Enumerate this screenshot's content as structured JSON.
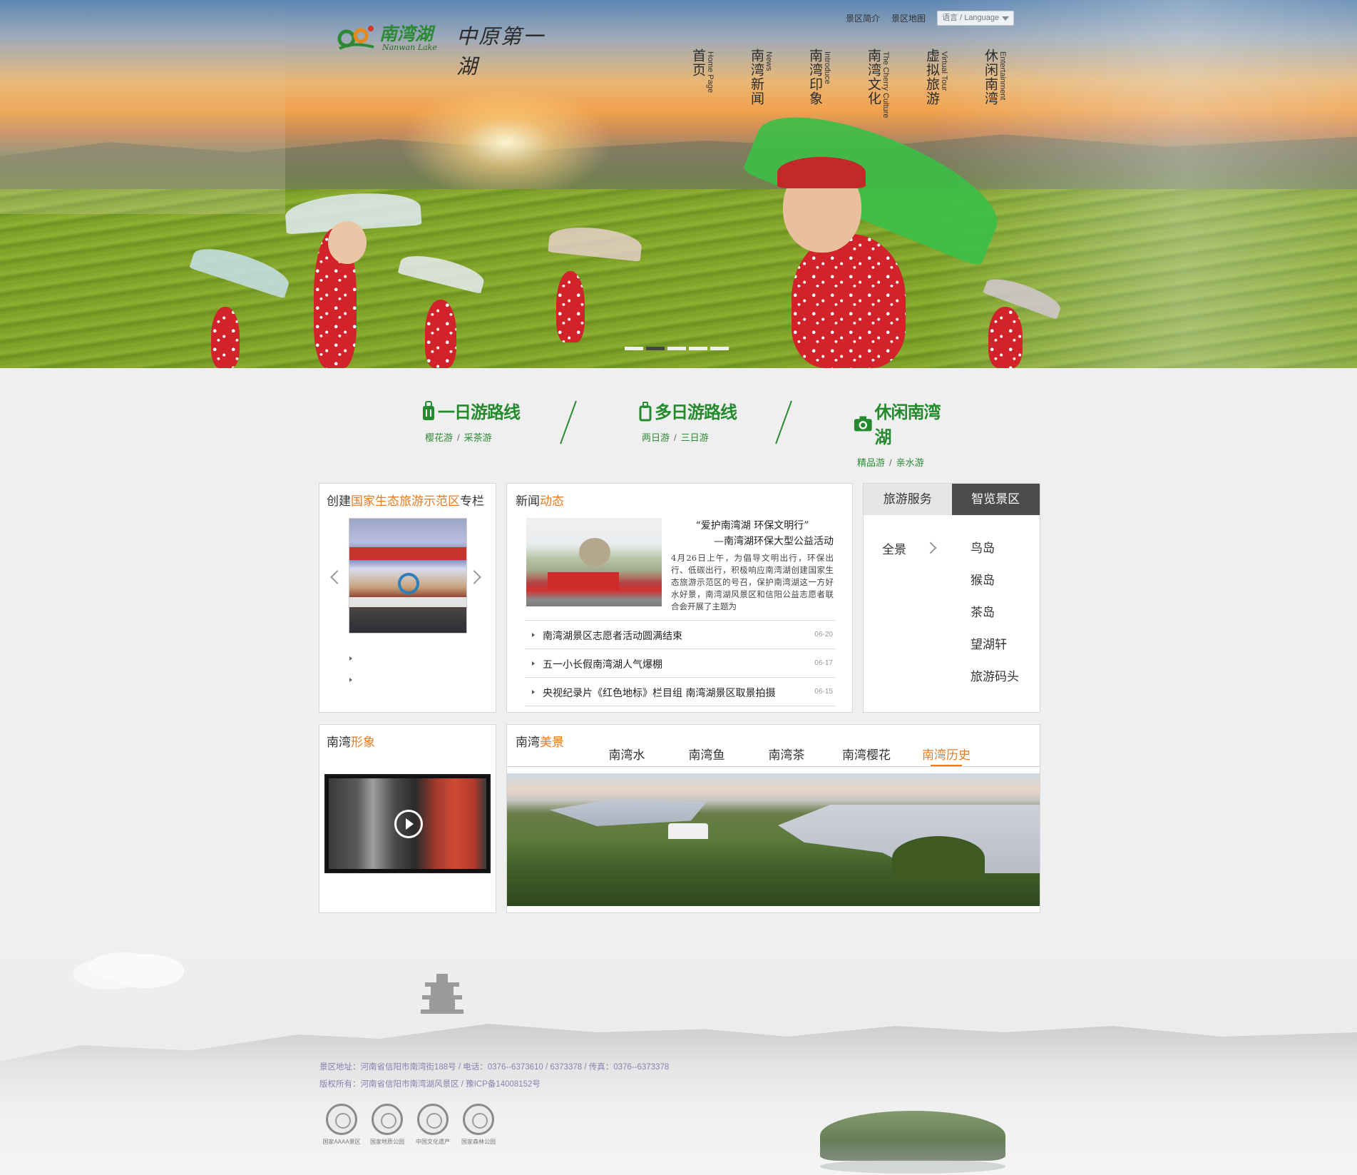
{
  "brand": {
    "name": "南湾湖",
    "english": "Nanwan Lake",
    "slogan": "中原第一湖",
    "green": "#248a2d",
    "orange": "#ec7a1f"
  },
  "top_links": {
    "intro": "景区简介",
    "map": "景区地图",
    "language": "语言 / Language"
  },
  "nav": [
    {
      "zh": "首页",
      "en": "Home Page"
    },
    {
      "zh": "南湾新闻",
      "en": "News"
    },
    {
      "zh": "南湾印象",
      "en": "Introduce"
    },
    {
      "zh": "南湾文化",
      "en": "The Cherry Culture"
    },
    {
      "zh": "虚拟旅游",
      "en": "Virtual Tour"
    },
    {
      "zh": "休闲南湾",
      "en": "Entertainment"
    }
  ],
  "slider": {
    "count": 5,
    "active_index": 1
  },
  "routes": [
    {
      "title": "一日游路线",
      "icon": "luggage-icon",
      "subs": [
        "樱花游",
        "采茶游"
      ]
    },
    {
      "title": "多日游路线",
      "icon": "suitcase-icon",
      "subs": [
        "两日游",
        "三日游"
      ]
    },
    {
      "title": "休闲南湾湖",
      "icon": "camera-icon",
      "subs": [
        "精品游",
        "亲水游"
      ]
    }
  ],
  "eco": {
    "title_a": "创建",
    "title_hl": "国家生态旅游示范区",
    "title_b": "专栏"
  },
  "news": {
    "title_a": "新闻",
    "title_hl": "动态",
    "lead_title_1": "“爱护南湾湖 环保文明行”",
    "lead_title_2": "—南湾湖环保大型公益活动",
    "lead_body": "4月26日上午，为倡导文明出行，环保出行、低碳出行，积极响应南湾湖创建国家生态旅游示范区的号召，保护南湾湖这一方好水好景，南湾湖风景区和信阳公益志愿者联合会开展了主题为",
    "items": [
      {
        "title": "南湾湖景区志愿者活动圆满结束",
        "date": "06-20"
      },
      {
        "title": "五一小长假南湾湖人气爆棚",
        "date": "06-17"
      },
      {
        "title": "央视纪录片《红色地标》栏目组 南湾湖景区取景拍摄",
        "date": "06-15"
      }
    ]
  },
  "service": {
    "tabs": [
      "旅游服务",
      "智览景区"
    ],
    "active_tab": 1,
    "all_label": "全景",
    "places": [
      "鸟岛",
      "猴岛",
      "茶岛",
      "望湖轩",
      "旅游码头"
    ]
  },
  "image_panel": {
    "title_a": "南湾",
    "title_hl": "形象"
  },
  "scenery": {
    "title_a": "南湾",
    "title_hl": "美景",
    "tabs": [
      "南湾水",
      "南湾鱼",
      "南湾茶",
      "南湾樱花",
      "南湾历史"
    ],
    "active_tab": 4
  },
  "footer": {
    "address": "景区地址：河南省信阳市南湾街188号 / 电话：0376--6373610 / 6373378 / 传真：0376--6373378",
    "copyright": "版权所有：河南省信阳市南湾湖风景区 / 豫ICP备14008152号",
    "badges": [
      "国家AAAA景区",
      "国家地质公园",
      "中国文化遗产",
      "国家森林公园"
    ]
  }
}
